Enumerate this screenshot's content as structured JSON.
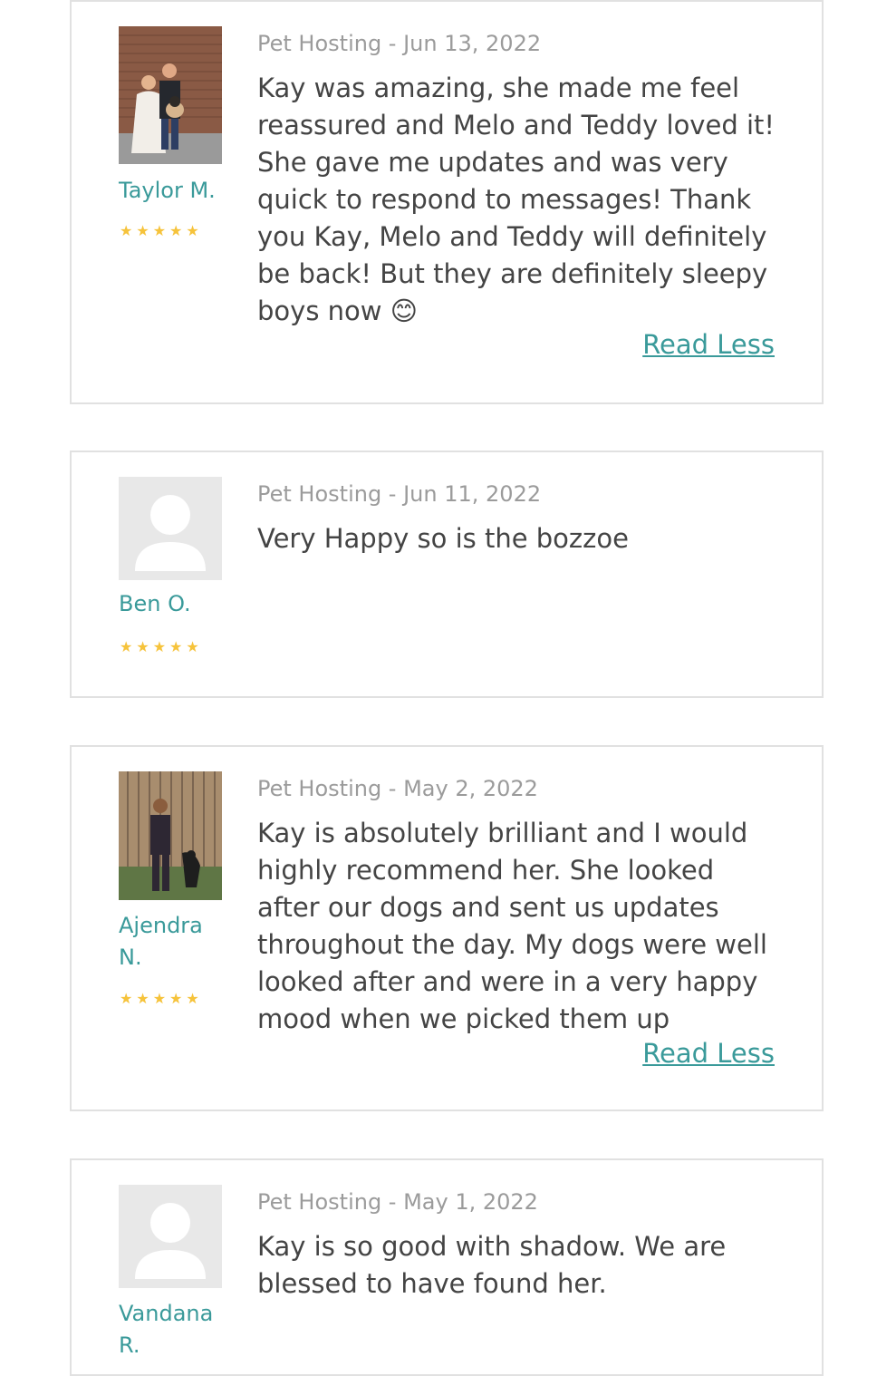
{
  "reviews": [
    {
      "reviewer": "Taylor M.",
      "meta": "Pet Hosting - Jun 13, 2022",
      "text": "Kay was amazing, she made me feel reassured and Melo and Teddy loved it! She gave me updates and was very quick to respond to messages! Thank you Kay, Melo and Teddy will definitely be back! But they are definitely sleepy boys now 😊",
      "rating": 5,
      "read_less": "Read Less"
    },
    {
      "reviewer": "Ben O.",
      "meta": "Pet Hosting - Jun 11, 2022",
      "text": "Very Happy so is the bozzoe",
      "rating": 5
    },
    {
      "reviewer": "Ajendra N.",
      "meta": "Pet Hosting - May 2, 2022",
      "text": "Kay is absolutely brilliant and I would highly recommend her. She looked after our dogs and sent us updates throughout the day. My dogs were well looked after and were in a very happy mood when we picked them up",
      "rating": 5,
      "read_less": "Read Less"
    },
    {
      "reviewer": "Vandana R.",
      "meta": "Pet Hosting - May 1, 2022",
      "text": "Kay is so good with shadow. We are blessed to have found her."
    }
  ],
  "colors": {
    "accent": "#3a9a9a",
    "star": "#f6c33b",
    "meta": "#9b9b9b",
    "body_text": "#444444",
    "border": "#e1e1e1"
  },
  "icons": {
    "star": "star-icon",
    "placeholder_avatar": "user-placeholder-icon"
  }
}
